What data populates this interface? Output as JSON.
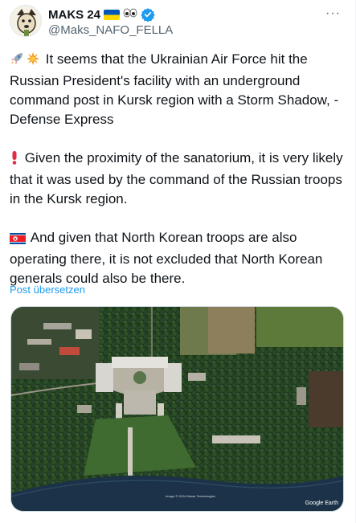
{
  "author": {
    "display_name": "MAKS 24",
    "name_emoji": [
      "flag-ukraine-icon",
      "eyes-icon",
      "verified-badge-icon"
    ],
    "handle": "@Maks_NAFO_FELLA"
  },
  "more_label": "···",
  "paragraphs": [
    {
      "icons": [
        "rocket-icon",
        "explosion-icon"
      ],
      "text": "It seems that the Ukrainian Air Force hit the Russian President's facility with an underground command post in Kursk region with a Storm Shadow, - Defense Express"
    },
    {
      "icons": [
        "exclamation-icon"
      ],
      "text": "Given the proximity of the sanatorium, it is very likely that it was used by the command of the Russian troops in the Kursk region."
    },
    {
      "icons": [
        "flag-north-korea-icon"
      ],
      "text": "And given that North Korean troops are also operating there, it is not excluded that North Korean generals could also be there."
    }
  ],
  "translate_label": "Post übersetzen",
  "media": {
    "credit": "Image © 2024 Maxar Technologies",
    "watermark": "Google Earth"
  },
  "colors": {
    "link": "#1d9bf0",
    "secondary_text": "#536471",
    "verified": "#1d9bf0"
  }
}
